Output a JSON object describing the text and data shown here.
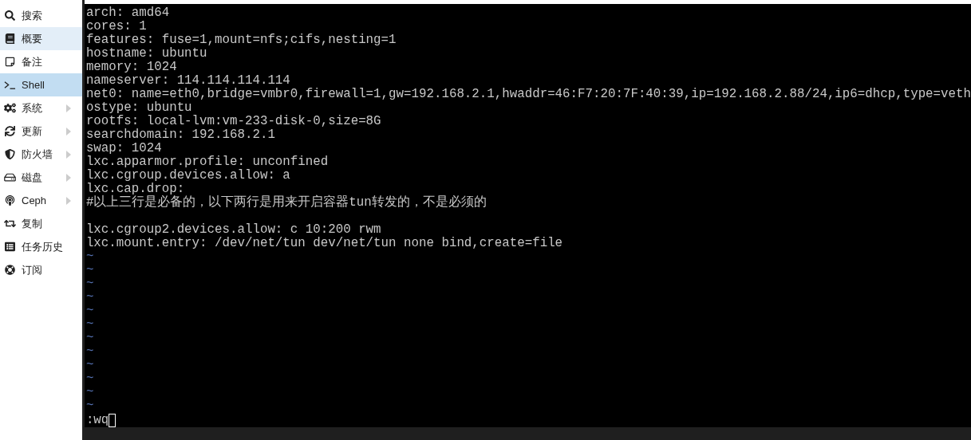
{
  "sidebar": {
    "items": [
      {
        "label": "搜索",
        "selected": false,
        "hovered": false,
        "has_submenu": false
      },
      {
        "label": "概要",
        "selected": false,
        "hovered": true,
        "has_submenu": false
      },
      {
        "label": "备注",
        "selected": false,
        "hovered": false,
        "has_submenu": false
      },
      {
        "label": "Shell",
        "selected": true,
        "hovered": false,
        "has_submenu": false
      },
      {
        "label": "系统",
        "selected": false,
        "hovered": false,
        "has_submenu": true
      },
      {
        "label": "更新",
        "selected": false,
        "hovered": false,
        "has_submenu": true
      },
      {
        "label": "防火墙",
        "selected": false,
        "hovered": false,
        "has_submenu": true
      },
      {
        "label": "磁盘",
        "selected": false,
        "hovered": false,
        "has_submenu": true
      },
      {
        "label": "Ceph",
        "selected": false,
        "hovered": false,
        "has_submenu": true
      },
      {
        "label": "复制",
        "selected": false,
        "hovered": false,
        "has_submenu": false
      },
      {
        "label": "任务历史",
        "selected": false,
        "hovered": false,
        "has_submenu": false
      },
      {
        "label": "订阅",
        "selected": false,
        "hovered": false,
        "has_submenu": false
      }
    ]
  },
  "terminal": {
    "lines": [
      {
        "kind": "text",
        "text": "arch: amd64"
      },
      {
        "kind": "text",
        "text": "cores: 1"
      },
      {
        "kind": "text",
        "text": "features: fuse=1,mount=nfs;cifs,nesting=1"
      },
      {
        "kind": "text",
        "text": "hostname: ubuntu"
      },
      {
        "kind": "text",
        "text": "memory: 1024"
      },
      {
        "kind": "text",
        "text": "nameserver: 114.114.114.114"
      },
      {
        "kind": "text",
        "text": "net0: name=eth0,bridge=vmbr0,firewall=1,gw=192.168.2.1,hwaddr=46:F7:20:7F:40:39,ip=192.168.2.88/24,ip6=dhcp,type=veth"
      },
      {
        "kind": "text",
        "text": "ostype: ubuntu"
      },
      {
        "kind": "text",
        "text": "rootfs: local-lvm:vm-233-disk-0,size=8G"
      },
      {
        "kind": "text",
        "text": "searchdomain: 192.168.2.1"
      },
      {
        "kind": "text",
        "text": "swap: 1024"
      },
      {
        "kind": "text",
        "text": "lxc.apparmor.profile: unconfined"
      },
      {
        "kind": "text",
        "text": "lxc.cgroup.devices.allow: a"
      },
      {
        "kind": "text",
        "text": "lxc.cap.drop:"
      },
      {
        "kind": "text",
        "text": "#以上三行是必备的，以下两行是用来开启容器tun转发的，不是必须的"
      },
      {
        "kind": "blank"
      },
      {
        "kind": "text",
        "text": "lxc.cgroup2.devices.allow: c 10:200 rwm"
      },
      {
        "kind": "text",
        "text": "lxc.mount.entry: /dev/net/tun dev/net/tun none bind,create=file"
      },
      {
        "kind": "tilde",
        "text": "~"
      },
      {
        "kind": "tilde",
        "text": "~"
      },
      {
        "kind": "tilde",
        "text": "~"
      },
      {
        "kind": "tilde",
        "text": "~"
      },
      {
        "kind": "tilde",
        "text": "~"
      },
      {
        "kind": "tilde",
        "text": "~"
      },
      {
        "kind": "tilde",
        "text": "~"
      },
      {
        "kind": "tilde",
        "text": "~"
      },
      {
        "kind": "tilde",
        "text": "~"
      },
      {
        "kind": "tilde",
        "text": "~"
      },
      {
        "kind": "tilde",
        "text": "~"
      },
      {
        "kind": "tilde",
        "text": "~"
      }
    ],
    "command": ":wq"
  }
}
